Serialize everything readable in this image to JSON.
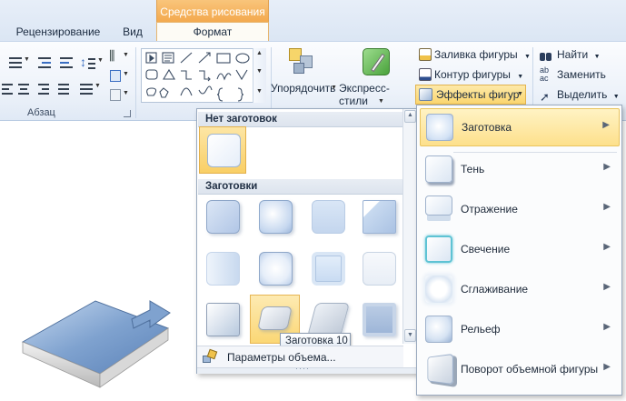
{
  "tabs": {
    "review": "Рецензирование",
    "view": "Вид",
    "context_header": "Средства рисования",
    "format": "Формат"
  },
  "ribbon": {
    "paragraph_group": "Абзац",
    "arrange": "Упорядочить",
    "quick_styles": "Экспресс-стили",
    "shape_fill": "Заливка фигуры",
    "shape_outline": "Контур фигуры",
    "shape_effects": "Эффекты фигур",
    "find": "Найти",
    "replace": "Заменить",
    "select": "Выделить"
  },
  "preset_panel": {
    "no_preset_header": "Нет заготовок",
    "presets_header": "Заготовки",
    "tooltip": "Заготовка 10",
    "footer": "Параметры объема..."
  },
  "effects_menu": {
    "items": [
      {
        "label": "Заготовка",
        "active": true
      },
      {
        "label": "Тень"
      },
      {
        "label": "Отражение"
      },
      {
        "label": "Свечение"
      },
      {
        "label": "Сглаживание"
      },
      {
        "label": "Рельеф"
      },
      {
        "label": "Поворот объемной фигуры"
      }
    ]
  },
  "colors": {
    "accent": "#f3a94e",
    "highlight": "#fbd66e",
    "ribbon": "#e0e9f5"
  }
}
